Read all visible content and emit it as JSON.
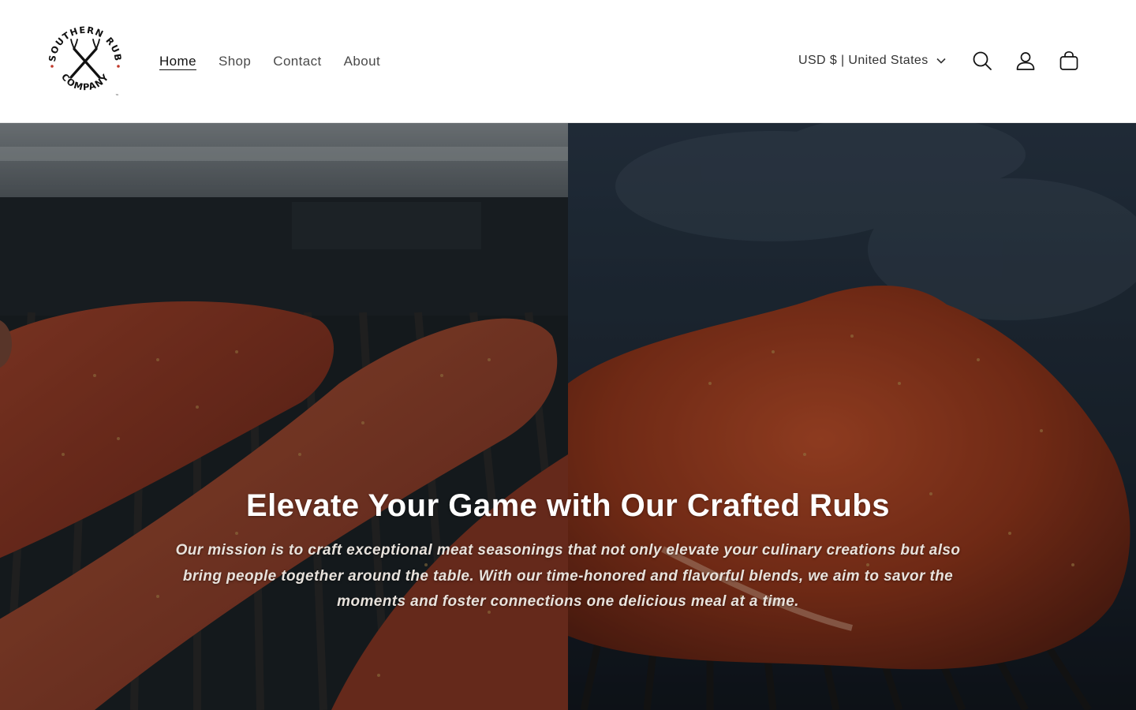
{
  "brand": {
    "logo_top_text": "SOUTHERN RUB",
    "logo_bottom_text": "COMPANY",
    "logo_tm": "™"
  },
  "nav": {
    "items": [
      {
        "label": "Home",
        "active": true
      },
      {
        "label": "Shop",
        "active": false
      },
      {
        "label": "Contact",
        "active": false
      },
      {
        "label": "About",
        "active": false
      }
    ]
  },
  "header": {
    "locale_label": "USD $ | United States",
    "icons": [
      "search-icon",
      "account-icon",
      "cart-icon"
    ]
  },
  "hero": {
    "title": "Elevate Your Game with Our Crafted Rubs",
    "text": "Our mission is to craft exceptional meat seasonings that not only elevate your culinary creations but also bring people together around the table. With our time-honored and flavorful blends, we aim to savor the moments and foster connections one delicious meal at a time."
  },
  "colors": {
    "text": "#121212",
    "nav_text": "#4a4a4a",
    "logo_dot": "#c0392b",
    "hero_text": "#ffffff"
  }
}
